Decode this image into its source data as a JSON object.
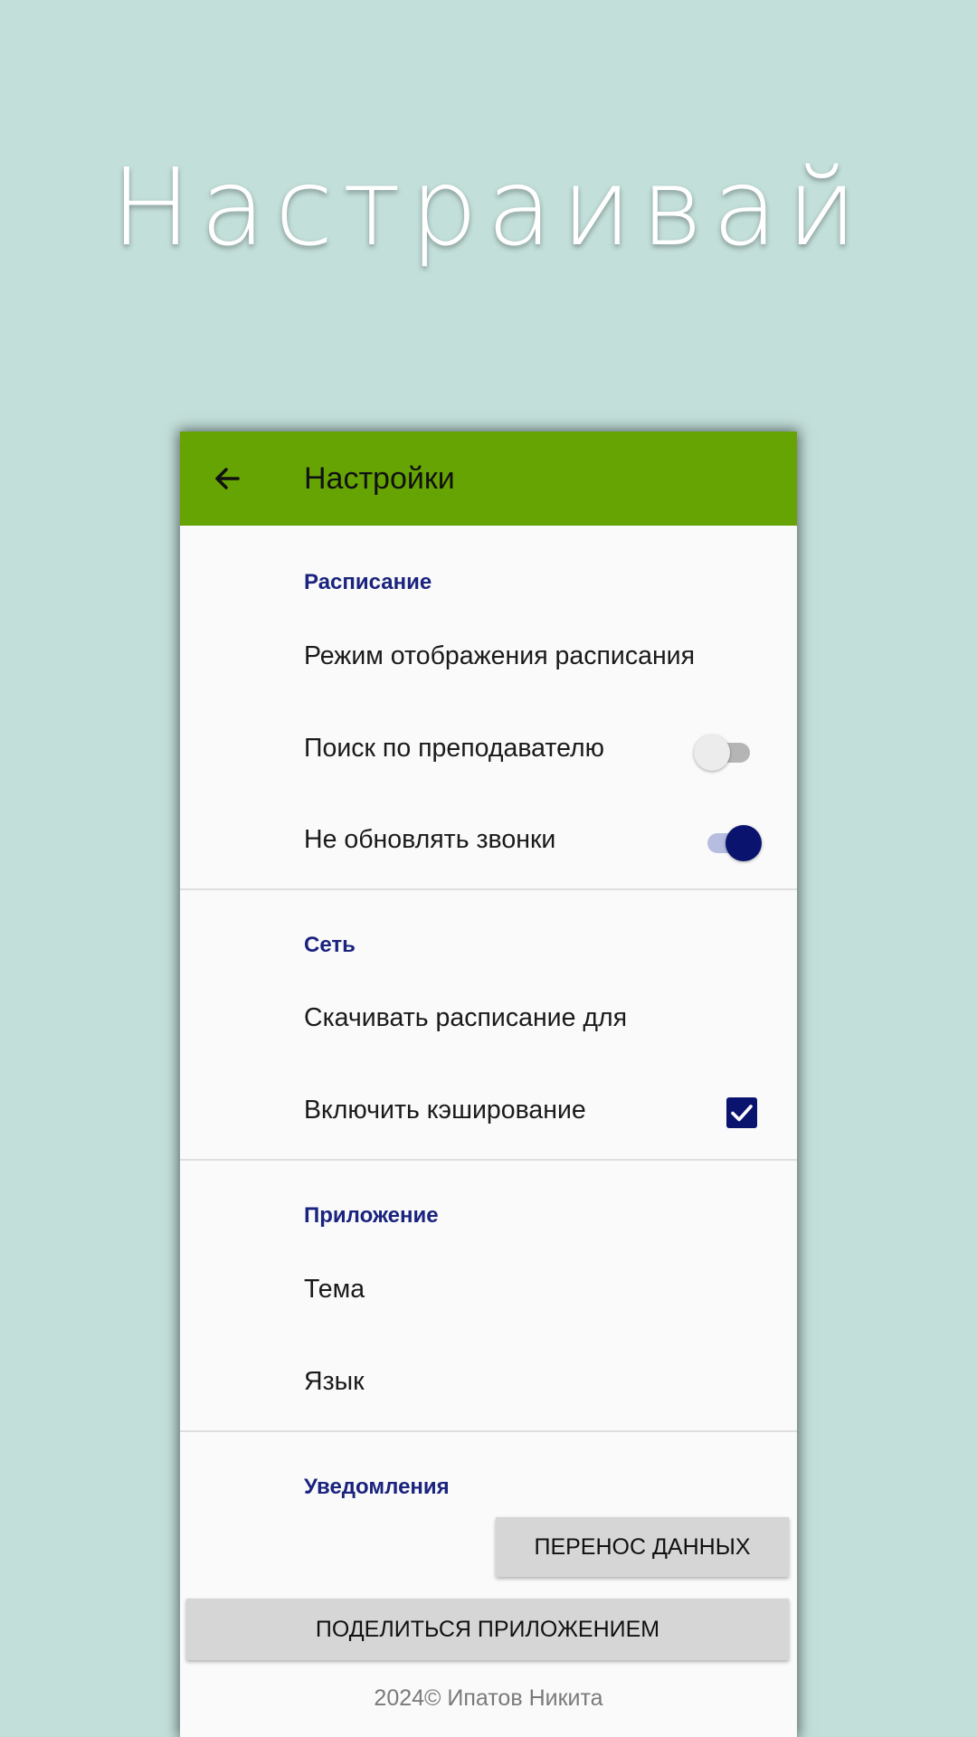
{
  "hero": {
    "title": "Настраивай"
  },
  "appbar": {
    "title": "Настройки",
    "back_icon": "arrow-back-icon",
    "color": "#66a403"
  },
  "sections": {
    "schedule": {
      "header": "Расписание",
      "display_mode": "Режим отображения расписания",
      "teacher_search": "Поиск по преподавателю",
      "teacher_search_on": false,
      "no_update_bells": "Не обновлять звонки",
      "no_update_bells_on": true
    },
    "network": {
      "header": "Сеть",
      "download_for": "Скачивать расписание для",
      "enable_caching": "Включить кэширование",
      "enable_caching_checked": true
    },
    "app": {
      "header": "Приложение",
      "theme": "Тема",
      "language": "Язык"
    },
    "notifications": {
      "header": "Уведомления"
    }
  },
  "buttons": {
    "transfer_data": "ПЕРЕНОС ДАННЫХ",
    "share_app": "ПОДЕЛИТЬСЯ ПРИЛОЖЕНИЕМ"
  },
  "footer": {
    "text": "2024© Ипатов Никита"
  },
  "colors": {
    "background": "#c3dfda",
    "accent": "#0a136e",
    "section_header": "#1a237e"
  }
}
